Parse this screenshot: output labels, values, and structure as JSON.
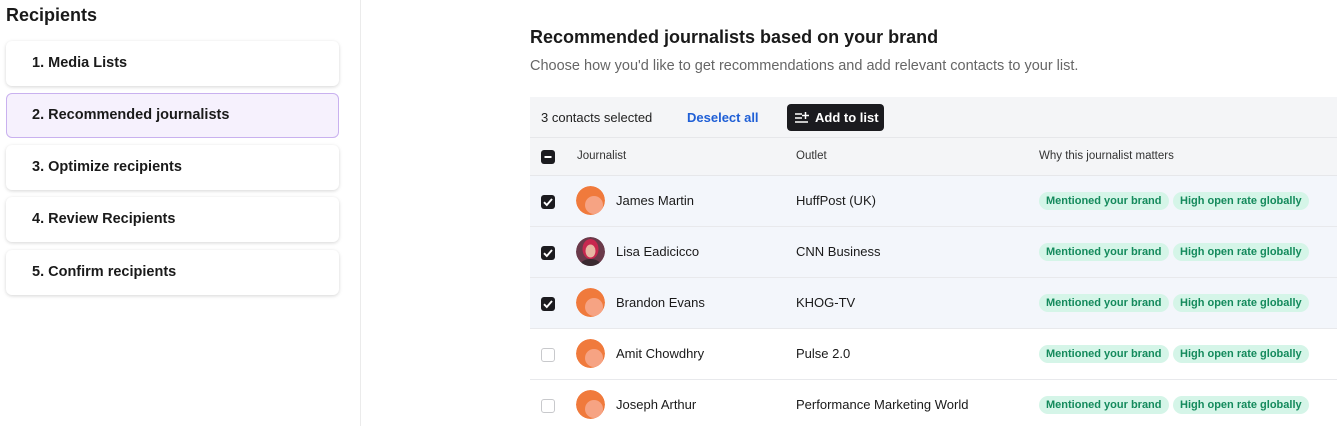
{
  "sidebar": {
    "title": "Recipients",
    "steps": [
      {
        "label": "1. Media Lists",
        "active": false
      },
      {
        "label": "2. Recommended journalists",
        "active": true
      },
      {
        "label": "3. Optimize recipients",
        "active": false
      },
      {
        "label": "4. Review Recipients",
        "active": false
      },
      {
        "label": "5. Confirm recipients",
        "active": false
      }
    ]
  },
  "main": {
    "title": "Recommended journalists based on your brand",
    "subtitle": "Choose how you'd like to get recommendations and add relevant contacts to your list."
  },
  "toolbar": {
    "selected_count": "3 contacts selected",
    "deselect_label": "Deselect all",
    "add_label": "Add to list"
  },
  "table": {
    "columns": [
      "Journalist",
      "Outlet",
      "Why this journalist matters"
    ],
    "rows": [
      {
        "name": "James Martin",
        "outlet": "HuffPost (UK)",
        "checked": true,
        "avatar": "default-avatar",
        "tags": [
          "Mentioned your brand",
          "High open rate globally"
        ]
      },
      {
        "name": "Lisa Eadicicco",
        "outlet": "CNN Business",
        "checked": true,
        "avatar": "photo-avatar",
        "tags": [
          "Mentioned your brand",
          "High open rate globally"
        ]
      },
      {
        "name": "Brandon Evans",
        "outlet": "KHOG-TV",
        "checked": true,
        "avatar": "default-avatar",
        "tags": [
          "Mentioned your brand",
          "High open rate globally"
        ]
      },
      {
        "name": "Amit Chowdhry",
        "outlet": "Pulse 2.0",
        "checked": false,
        "avatar": "default-avatar",
        "tags": [
          "Mentioned your brand",
          "High open rate globally"
        ]
      },
      {
        "name": "Joseph Arthur",
        "outlet": "Performance Marketing World",
        "checked": false,
        "avatar": "default-avatar",
        "tags": [
          "Mentioned your brand",
          "High open rate globally"
        ]
      }
    ]
  },
  "colors": {
    "accent_purple_border": "#c9b1ef",
    "active_step_bg": "#f6f1fd",
    "link_blue": "#1f5fd6",
    "badge_bg": "#d5f5e8",
    "badge_text": "#148a5c",
    "avatar_orange": "#f07a3c"
  }
}
